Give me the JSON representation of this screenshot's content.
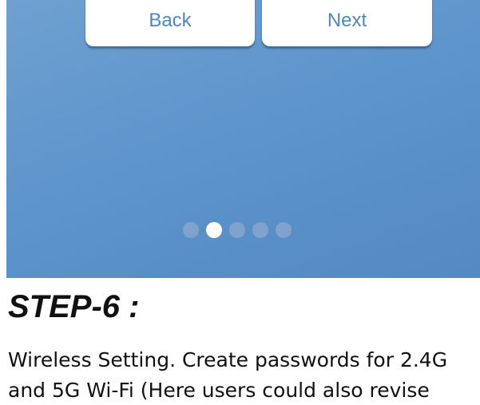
{
  "app_screen": {
    "back_label": "Back",
    "next_label": "Next",
    "page_indicator": {
      "total": 5,
      "active_index": 1
    },
    "colors": {
      "background": "#5e95cc",
      "button_text": "#4f86c2",
      "active_dot": "#ffffff"
    }
  },
  "step": {
    "title": "STEP-6 :",
    "description_lines": [
      "Wireless Setting. Create passwords for 2.4G",
      "and 5G Wi-Fi (Here users could also revise"
    ]
  }
}
